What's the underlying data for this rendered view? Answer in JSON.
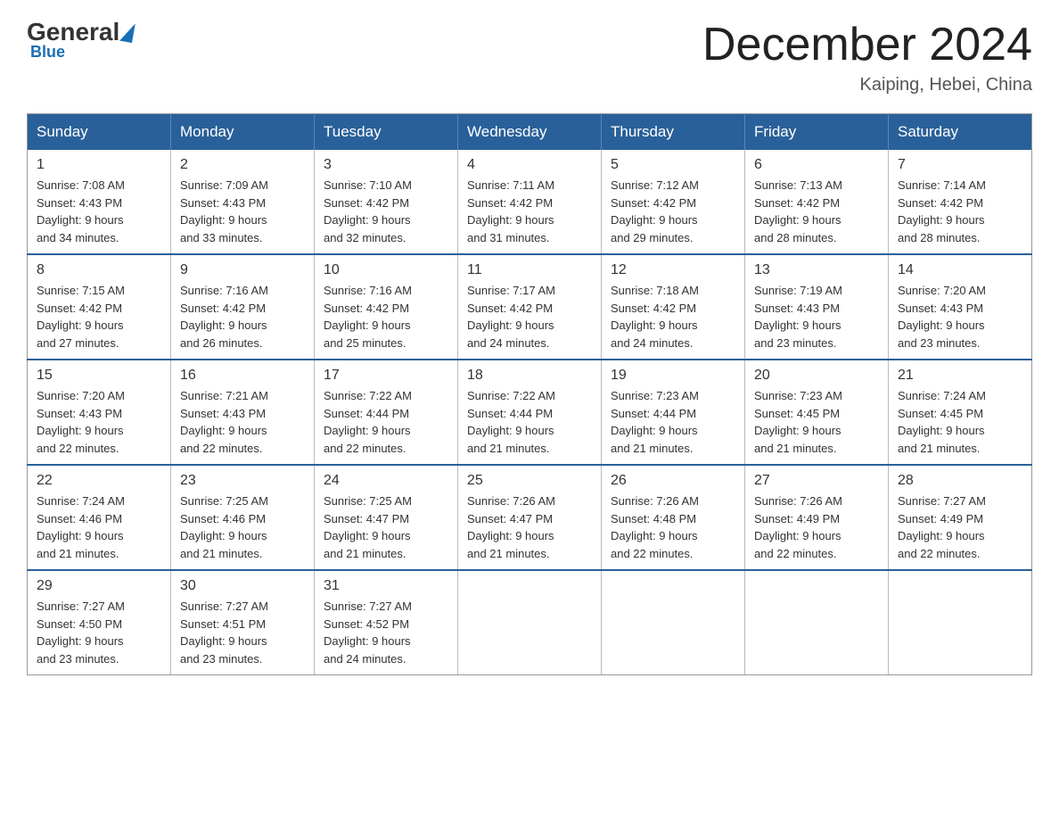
{
  "logo": {
    "general": "General",
    "blue": "Blue",
    "subtitle": "Blue"
  },
  "header": {
    "title": "December 2024",
    "location": "Kaiping, Hebei, China"
  },
  "days_of_week": [
    "Sunday",
    "Monday",
    "Tuesday",
    "Wednesday",
    "Thursday",
    "Friday",
    "Saturday"
  ],
  "weeks": [
    [
      {
        "day": "1",
        "sunrise": "7:08 AM",
        "sunset": "4:43 PM",
        "daylight": "9 hours and 34 minutes."
      },
      {
        "day": "2",
        "sunrise": "7:09 AM",
        "sunset": "4:43 PM",
        "daylight": "9 hours and 33 minutes."
      },
      {
        "day": "3",
        "sunrise": "7:10 AM",
        "sunset": "4:42 PM",
        "daylight": "9 hours and 32 minutes."
      },
      {
        "day": "4",
        "sunrise": "7:11 AM",
        "sunset": "4:42 PM",
        "daylight": "9 hours and 31 minutes."
      },
      {
        "day": "5",
        "sunrise": "7:12 AM",
        "sunset": "4:42 PM",
        "daylight": "9 hours and 29 minutes."
      },
      {
        "day": "6",
        "sunrise": "7:13 AM",
        "sunset": "4:42 PM",
        "daylight": "9 hours and 28 minutes."
      },
      {
        "day": "7",
        "sunrise": "7:14 AM",
        "sunset": "4:42 PM",
        "daylight": "9 hours and 28 minutes."
      }
    ],
    [
      {
        "day": "8",
        "sunrise": "7:15 AM",
        "sunset": "4:42 PM",
        "daylight": "9 hours and 27 minutes."
      },
      {
        "day": "9",
        "sunrise": "7:16 AM",
        "sunset": "4:42 PM",
        "daylight": "9 hours and 26 minutes."
      },
      {
        "day": "10",
        "sunrise": "7:16 AM",
        "sunset": "4:42 PM",
        "daylight": "9 hours and 25 minutes."
      },
      {
        "day": "11",
        "sunrise": "7:17 AM",
        "sunset": "4:42 PM",
        "daylight": "9 hours and 24 minutes."
      },
      {
        "day": "12",
        "sunrise": "7:18 AM",
        "sunset": "4:42 PM",
        "daylight": "9 hours and 24 minutes."
      },
      {
        "day": "13",
        "sunrise": "7:19 AM",
        "sunset": "4:43 PM",
        "daylight": "9 hours and 23 minutes."
      },
      {
        "day": "14",
        "sunrise": "7:20 AM",
        "sunset": "4:43 PM",
        "daylight": "9 hours and 23 minutes."
      }
    ],
    [
      {
        "day": "15",
        "sunrise": "7:20 AM",
        "sunset": "4:43 PM",
        "daylight": "9 hours and 22 minutes."
      },
      {
        "day": "16",
        "sunrise": "7:21 AM",
        "sunset": "4:43 PM",
        "daylight": "9 hours and 22 minutes."
      },
      {
        "day": "17",
        "sunrise": "7:22 AM",
        "sunset": "4:44 PM",
        "daylight": "9 hours and 22 minutes."
      },
      {
        "day": "18",
        "sunrise": "7:22 AM",
        "sunset": "4:44 PM",
        "daylight": "9 hours and 21 minutes."
      },
      {
        "day": "19",
        "sunrise": "7:23 AM",
        "sunset": "4:44 PM",
        "daylight": "9 hours and 21 minutes."
      },
      {
        "day": "20",
        "sunrise": "7:23 AM",
        "sunset": "4:45 PM",
        "daylight": "9 hours and 21 minutes."
      },
      {
        "day": "21",
        "sunrise": "7:24 AM",
        "sunset": "4:45 PM",
        "daylight": "9 hours and 21 minutes."
      }
    ],
    [
      {
        "day": "22",
        "sunrise": "7:24 AM",
        "sunset": "4:46 PM",
        "daylight": "9 hours and 21 minutes."
      },
      {
        "day": "23",
        "sunrise": "7:25 AM",
        "sunset": "4:46 PM",
        "daylight": "9 hours and 21 minutes."
      },
      {
        "day": "24",
        "sunrise": "7:25 AM",
        "sunset": "4:47 PM",
        "daylight": "9 hours and 21 minutes."
      },
      {
        "day": "25",
        "sunrise": "7:26 AM",
        "sunset": "4:47 PM",
        "daylight": "9 hours and 21 minutes."
      },
      {
        "day": "26",
        "sunrise": "7:26 AM",
        "sunset": "4:48 PM",
        "daylight": "9 hours and 22 minutes."
      },
      {
        "day": "27",
        "sunrise": "7:26 AM",
        "sunset": "4:49 PM",
        "daylight": "9 hours and 22 minutes."
      },
      {
        "day": "28",
        "sunrise": "7:27 AM",
        "sunset": "4:49 PM",
        "daylight": "9 hours and 22 minutes."
      }
    ],
    [
      {
        "day": "29",
        "sunrise": "7:27 AM",
        "sunset": "4:50 PM",
        "daylight": "9 hours and 23 minutes."
      },
      {
        "day": "30",
        "sunrise": "7:27 AM",
        "sunset": "4:51 PM",
        "daylight": "9 hours and 23 minutes."
      },
      {
        "day": "31",
        "sunrise": "7:27 AM",
        "sunset": "4:52 PM",
        "daylight": "9 hours and 24 minutes."
      },
      null,
      null,
      null,
      null
    ]
  ],
  "labels": {
    "sunrise": "Sunrise:",
    "sunset": "Sunset:",
    "daylight": "Daylight:"
  }
}
